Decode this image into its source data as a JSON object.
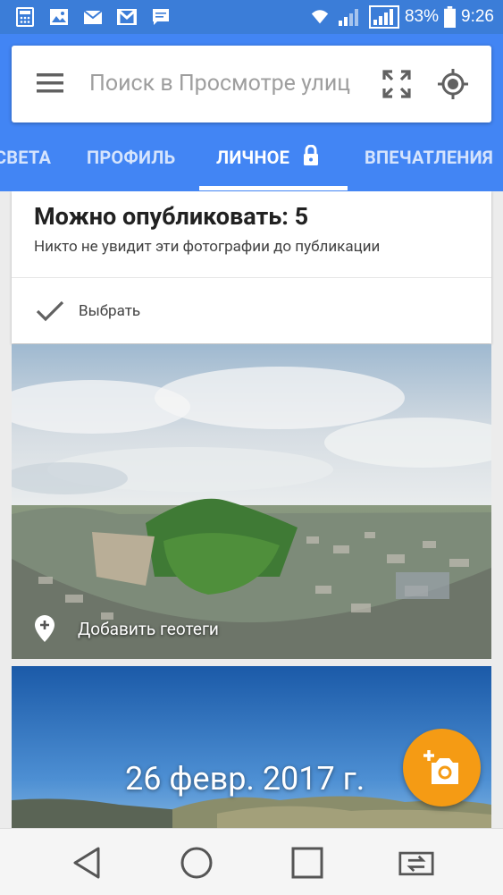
{
  "status_bar": {
    "battery_percent": "83%",
    "time": "9:26",
    "icons": [
      "calculator-icon",
      "gallery-icon",
      "mail-icon",
      "gmail-icon",
      "message-icon",
      "wifi-icon",
      "signal-icon",
      "battery-icon"
    ]
  },
  "search": {
    "placeholder": "Поиск в Просмотре улиц"
  },
  "tabs": [
    {
      "label": "Света",
      "active": false
    },
    {
      "label": "Профиль",
      "active": false
    },
    {
      "label": "Личное",
      "active": true
    },
    {
      "label": "Впечатления",
      "active": false
    }
  ],
  "publish_card": {
    "title": "Можно опубликовать: 5",
    "subtitle": "Никто не увидит эти фотографии до публикации",
    "select_label": "Выбрать"
  },
  "photo1": {
    "geotag_label": "Добавить геотеги"
  },
  "photo2": {
    "date_label": "26 февр. 2017 г."
  },
  "colors": {
    "status_bar": "#3b7dd8",
    "app_bar": "#4285f4",
    "fab": "#f59b14"
  }
}
